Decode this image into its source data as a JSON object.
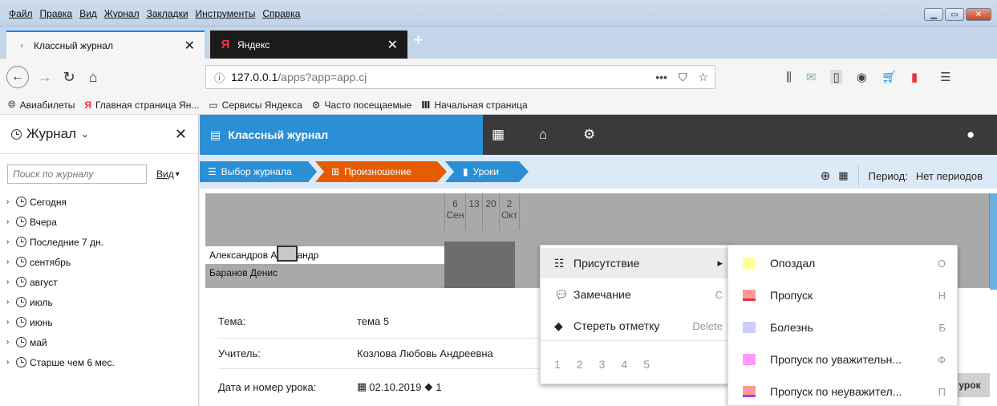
{
  "menubar": {
    "items": [
      "Файл",
      "Правка",
      "Вид",
      "Журнал",
      "Закладки",
      "Инструменты",
      "Справка"
    ]
  },
  "tabs": [
    {
      "title": "Классный журнал",
      "active": true
    },
    {
      "title": "Яндекс",
      "active": false
    }
  ],
  "urlbar": {
    "host": "127.0.0.1",
    "path": "/apps?app=app.cj",
    "more": "•••"
  },
  "bookmarks": [
    {
      "label": "Авиабилеты",
      "icon": "globe-icon"
    },
    {
      "label": "Главная страница Ян...",
      "icon": "yandex-icon"
    },
    {
      "label": "Сервисы Яндекса",
      "icon": "folder-icon"
    },
    {
      "label": "Часто посещаемые",
      "icon": "gear-icon"
    },
    {
      "label": "Начальная страница",
      "icon": "home-page-icon"
    }
  ],
  "sidebar": {
    "title": "Журнал",
    "search_placeholder": "Поиск по журналу",
    "view_label": "Вид",
    "items": [
      "Сегодня",
      "Вчера",
      "Последние 7 дн.",
      "сентябрь",
      "август",
      "июль",
      "июнь",
      "май",
      "Старше чем 6 мес."
    ]
  },
  "app": {
    "title": "Классный журнал",
    "breadcrumbs": [
      "Выбор журнала",
      "Произношение",
      "Уроки"
    ],
    "period_label": "Период:",
    "period_value": "Нет периодов",
    "accent": "#2b8fd6",
    "orange": "#e55c00"
  },
  "grid": {
    "columns": [
      {
        "day": "6",
        "month": "Сен"
      },
      {
        "day": "13",
        "month": ""
      },
      {
        "day": "20",
        "month": ""
      },
      {
        "day": "2",
        "month": "Окт"
      }
    ],
    "students": [
      "Александров Александр",
      "Баранов Денис"
    ]
  },
  "lesson": {
    "topic_label": "Тема:",
    "topic_value": "тема 5",
    "teacher_label": "Учитель:",
    "teacher_value": "Козлова Любовь Андреевна",
    "date_label": "Дата и номер урока:",
    "date_value": "02.10.2019",
    "lesson_number": "1",
    "button_label": "урок"
  },
  "context_menu": {
    "items": [
      {
        "label": "Присутствие",
        "shortcut": "▸",
        "icon": "list-icon"
      },
      {
        "label": "Замечание",
        "shortcut": "C",
        "icon": "comment-icon"
      },
      {
        "label": "Стереть отметку",
        "shortcut": "Delete",
        "icon": "eraser-icon"
      }
    ],
    "numbers": [
      "1",
      "2",
      "3",
      "4",
      "5"
    ]
  },
  "submenu": {
    "items": [
      {
        "label": "Опоздал",
        "shortcut": "О",
        "color": "#ffff99"
      },
      {
        "label": "Пропуск",
        "shortcut": "Н",
        "color": "#ff9999"
      },
      {
        "label": "Болезнь",
        "shortcut": "Б",
        "color": "#ccccff"
      },
      {
        "label": "Пропуск по уважительн...",
        "shortcut": "Ф",
        "color": "#ff99ff"
      },
      {
        "label": "Пропуск по неуважител...",
        "shortcut": "П",
        "color": "#ff9999"
      }
    ]
  }
}
